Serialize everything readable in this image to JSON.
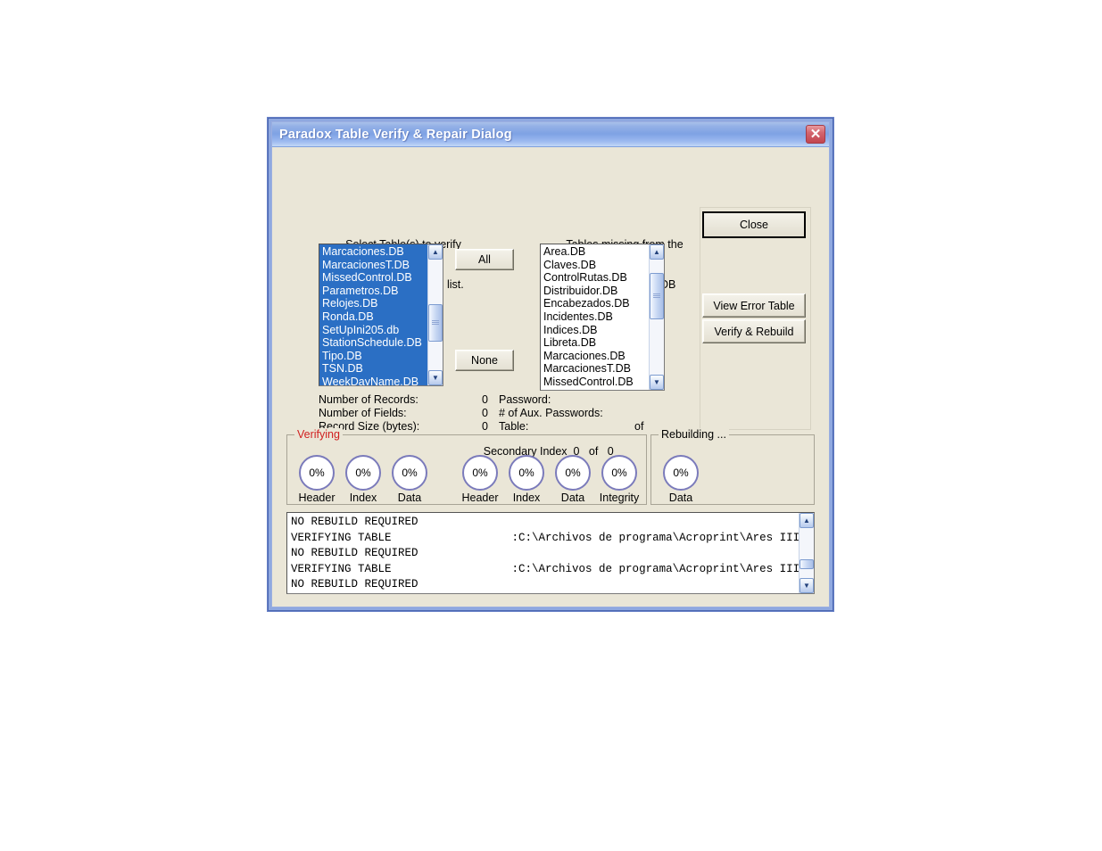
{
  "window": {
    "title": "Paradox Table Verify & Repair Dialog",
    "close_icon": "close-icon",
    "close_glyph": "✕",
    "titlebar_color": "#7ea2e4",
    "body_color": "#eae6d7"
  },
  "left_list": {
    "caption_line1": "Select Table(s) to verify",
    "caption_line2": "and rebuild from this list.",
    "selected_color": "#2b6fc4",
    "items": [
      "Marcaciones.DB",
      "MarcacionesT.DB",
      "MissedControl.DB",
      "Parametros.DB",
      "Relojes.DB",
      "Ronda.DB",
      "SetUpIni205.db",
      "StationSchedule.DB",
      "Tipo.DB",
      "TSN.DB",
      "WeekDayName.DB"
    ],
    "scroll_up_glyph": "▲",
    "scroll_down_glyph": "▼"
  },
  "right_list": {
    "caption_line1": "Tables missing from the",
    "caption_line2": "Borrow Structure DB",
    "items": [
      "Area.DB",
      "Claves.DB",
      "ControlRutas.DB",
      "Distribuidor.DB",
      "Encabezados.DB",
      "Incidentes.DB",
      "Indices.DB",
      "Libreta.DB",
      "Marcaciones.DB",
      "MarcacionesT.DB",
      "MissedControl.DB"
    ],
    "scroll_up_glyph": "▲",
    "scroll_down_glyph": "▼"
  },
  "select_buttons": {
    "all": "All",
    "none": "None"
  },
  "action_buttons": {
    "close": "Close",
    "view_error_table": "View Error Table",
    "verify_rebuild": "Verify & Rebuild"
  },
  "info": {
    "records_label": "Number of Records:",
    "records_value": "0",
    "fields_label": "Number of Fields:",
    "fields_value": "0",
    "recsize_label": "Record Size (bytes):",
    "recsize_value": "0",
    "password_label": "Password:",
    "password_value": "",
    "aux_pw_label": "# of Aux. Passwords:",
    "aux_pw_value": "",
    "table_label": "Table:",
    "table_value": "",
    "table_of": "of",
    "table_total": ""
  },
  "verifying": {
    "group_title": "Verifying",
    "group_title_color": "#d01f1f",
    "secondary_index_label": "Secondary Index",
    "secondary_index_current": "0",
    "secondary_index_of": "of",
    "secondary_index_total": "0",
    "circle_border_color": "#7b7bbb",
    "primary": [
      {
        "value": "0%",
        "caption": "Header"
      },
      {
        "value": "0%",
        "caption": "Index"
      },
      {
        "value": "0%",
        "caption": "Data"
      }
    ],
    "secondary": [
      {
        "value": "0%",
        "caption": "Header"
      },
      {
        "value": "0%",
        "caption": "Index"
      },
      {
        "value": "0%",
        "caption": "Data"
      },
      {
        "value": "0%",
        "caption": "Integrity"
      }
    ]
  },
  "rebuilding": {
    "group_title": "Rebuilding ...",
    "circles": [
      {
        "value": "0%",
        "caption": "Data"
      }
    ]
  },
  "log": {
    "lines": [
      "NO REBUILD REQUIRED",
      "VERIFYING TABLE                  :C:\\Archivos de programa\\Acroprint\\Ares III",
      "NO REBUILD REQUIRED",
      "VERIFYING TABLE                  :C:\\Archivos de programa\\Acroprint\\Ares III",
      "NO REBUILD REQUIRED"
    ],
    "scroll_up_glyph": "▲",
    "scroll_down_glyph": "▼"
  }
}
